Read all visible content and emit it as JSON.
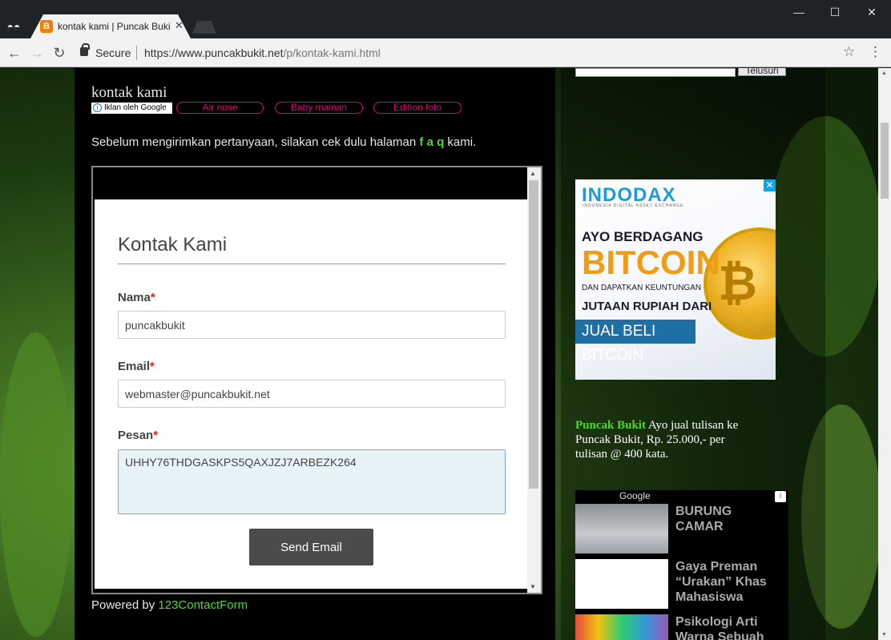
{
  "browser": {
    "tab_title": "kontak kami | Puncak Bukit",
    "favicon_letter": "B",
    "secure_label": "Secure",
    "url_host": "https://www.puncakbukit.net",
    "url_path": "/p/kontak-kami.html",
    "window_controls": {
      "minimize": "—",
      "maximize": "☐",
      "close": "✕"
    }
  },
  "post": {
    "title": "kontak kami",
    "ad_info_label": "Iklan oleh Google",
    "ad_links": [
      "Air nose",
      "Baby mainan",
      "Edition foto"
    ],
    "intro_before": "Sebelum mengirimkan pertanyaan, silakan cek dulu halaman ",
    "intro_link": "f a q",
    "intro_after": " kami."
  },
  "form": {
    "title": "Kontak Kami",
    "name_label": "Nama",
    "name_value": "puncakbukit",
    "email_label": "Email",
    "email_value": "webmaster@puncakbukit.net",
    "message_label": "Pesan",
    "message_value": "UHHY76THDGASKPS5QAXJZJ7ARBEZK264",
    "required_mark": "*",
    "submit_label": "Send Email"
  },
  "powered": {
    "prefix": "Powered by ",
    "link": "123ContactForm"
  },
  "sidebar": {
    "search_button": "Telusuri",
    "indodax_ad": {
      "logo": "INDODAX",
      "tagline": "INDONESIA DIGITAL ASSET EXCHANGE",
      "line1": "AYO BERDAGANG",
      "line2": "BITCOIN",
      "line3": "DAN DAPATKAN KEUNTUNGAN",
      "line4": "JUTAAN RUPIAH DARI",
      "line5": "JUAL BELI BITCOIN",
      "coin_symbol": "₿",
      "close": "✕"
    },
    "promo": {
      "brand": "Puncak Bukit",
      "text": " Ayo jual tulisan ke Puncak Bukit, Rp. 25.000,- per tulisan @ 400 kata."
    },
    "google_ads": {
      "label": "Google",
      "info": "i",
      "items": [
        {
          "text": "BURUNG CAMAR"
        },
        {
          "text": "Gaya Preman “Urakan” Khas Mahasiswa"
        },
        {
          "text": "Psikologi Arti Warna Sebuah"
        }
      ]
    }
  },
  "colors": {
    "accent_green": "#4cd92a",
    "ad_pink": "#e0007a",
    "button_dark": "#4b4b4b"
  }
}
